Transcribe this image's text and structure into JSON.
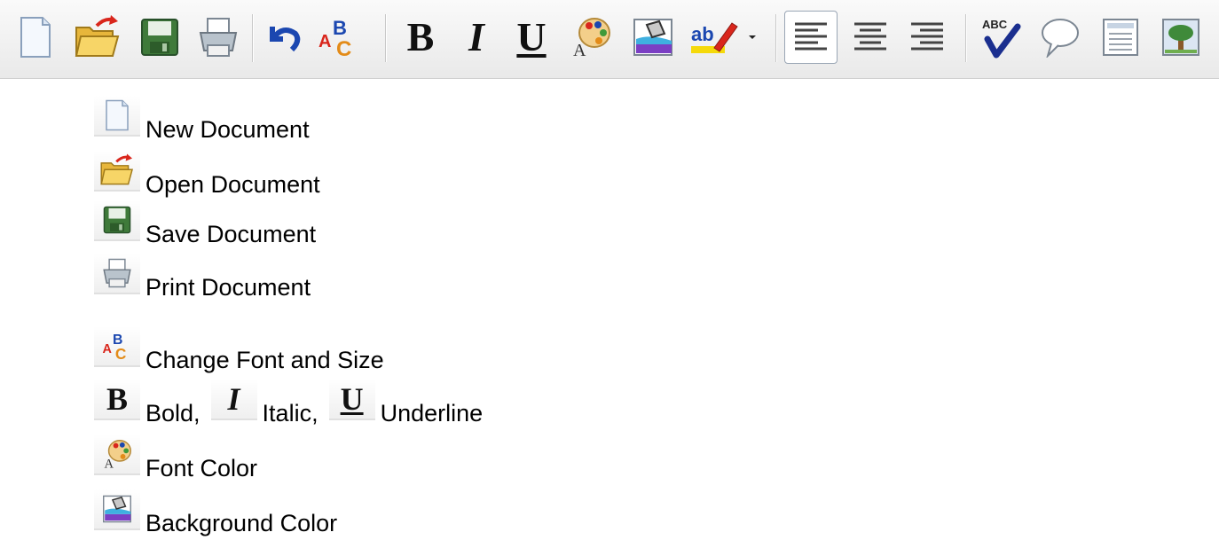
{
  "toolbar": {
    "buttons": [
      {
        "name": "new-document",
        "icon": "blank-page-icon"
      },
      {
        "name": "open-document",
        "icon": "folder-arrow-icon"
      },
      {
        "name": "save-document",
        "icon": "floppy-disk-icon"
      },
      {
        "name": "print-document",
        "icon": "printer-icon"
      },
      {
        "name": "undo",
        "icon": "undo-arrow-icon"
      },
      {
        "name": "change-font-size",
        "icon": "abc-font-icon"
      },
      {
        "name": "bold",
        "glyph": "B"
      },
      {
        "name": "italic",
        "glyph": "I"
      },
      {
        "name": "underline",
        "glyph": "U"
      },
      {
        "name": "font-color",
        "icon": "palette-icon"
      },
      {
        "name": "background-color",
        "icon": "paint-bucket-icon"
      },
      {
        "name": "highlight",
        "icon": "highlighter-icon"
      },
      {
        "name": "highlight-dropdown",
        "glyph": "▾"
      },
      {
        "name": "align-left",
        "icon": "align-left-icon",
        "active": true
      },
      {
        "name": "align-center",
        "icon": "align-center-icon"
      },
      {
        "name": "align-right",
        "icon": "align-right-icon"
      },
      {
        "name": "spell-check",
        "icon": "abc-check-icon"
      },
      {
        "name": "comment",
        "icon": "speech-bubble-icon"
      },
      {
        "name": "page-view",
        "icon": "document-view-icon"
      },
      {
        "name": "insert-image",
        "icon": "tree-image-icon"
      }
    ],
    "colors": {
      "red": "#d9261c",
      "blue": "#1b47b0",
      "green": "#3f7a3a",
      "folder": "#f2c44a"
    }
  },
  "legend": {
    "new_document": "New Document",
    "open_document": "Open Document",
    "save_document": "Save Document",
    "print_document": "Print Document",
    "change_font": "Change Font and Size",
    "bold_glyph": "B",
    "bold": "Bold,",
    "italic_glyph": "I",
    "italic": "Italic,",
    "underline_glyph": "U",
    "underline": "Underline",
    "font_color": "Font Color",
    "background_color": "Background Color"
  }
}
